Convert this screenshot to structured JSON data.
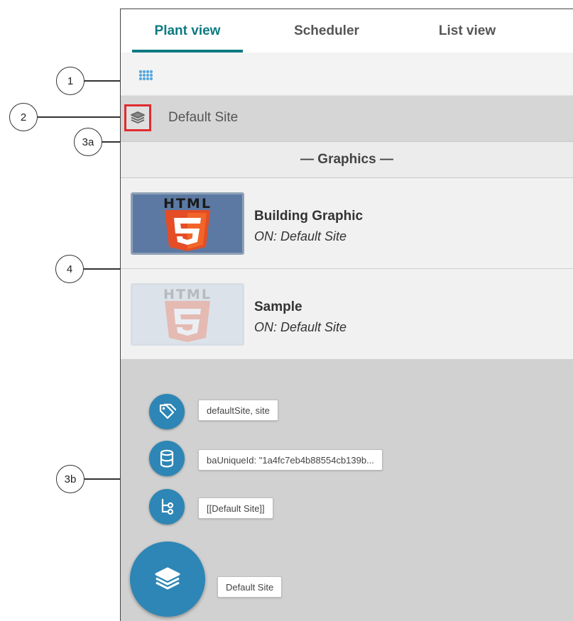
{
  "tabs": [
    {
      "label": "Plant view",
      "active": true
    },
    {
      "label": "Scheduler",
      "active": false
    },
    {
      "label": "List view",
      "active": false
    }
  ],
  "callouts": {
    "c1": "1",
    "c2": "2",
    "c3a": "3a",
    "c4": "4",
    "c3b": "3b"
  },
  "site": {
    "title": "Default Site",
    "icon": "layers-icon"
  },
  "graphics": {
    "header": "— Graphics —",
    "items": [
      {
        "name": "Building Graphic",
        "location": "ON: Default Site",
        "thumb_text": "HTML",
        "thumb_icon": "html5-icon"
      },
      {
        "name": "Sample",
        "location": "ON: Default Site",
        "thumb_text": "HTML",
        "thumb_icon": "html5-icon"
      }
    ]
  },
  "info": {
    "tags": "defaultSite, site",
    "unique_id": "baUniqueId: \"1a4fc7eb4b88554cb139b...",
    "path": "[[Default Site]]",
    "site_name": "Default Site"
  },
  "colors": {
    "accent": "#0d7a83",
    "fab": "#2d86b5",
    "highlight": "#e12b2f",
    "html5_orange": "#e44d26"
  }
}
